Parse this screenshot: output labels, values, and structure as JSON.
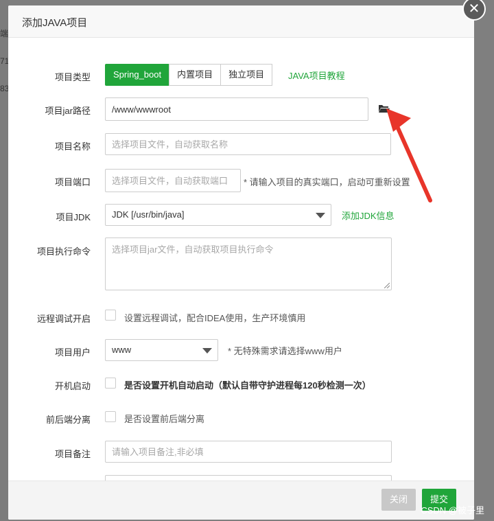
{
  "background": {
    "edge_texts": [
      "端",
      "71",
      "83"
    ]
  },
  "dialog": {
    "title": "添加JAVA项目",
    "close_icon": "close-icon",
    "project_type": {
      "label": "项目类型",
      "options": [
        "Spring_boot",
        "内置项目",
        "独立项目"
      ],
      "selected": "Spring_boot",
      "tutorial_link": "JAVA项目教程"
    },
    "jar_path": {
      "label": "项目jar路径",
      "value": "/www/wwwroot",
      "folder_icon": "folder-open-icon"
    },
    "project_name": {
      "label": "项目名称",
      "placeholder": "选择项目文件，自动获取名称"
    },
    "project_port": {
      "label": "项目端口",
      "placeholder": "选择项目文件，自动获取端口",
      "hint": "* 请输入项目的真实端口，启动可重新设置"
    },
    "project_jdk": {
      "label": "项目JDK",
      "selected": "JDK [/usr/bin/java]",
      "add_link": "添加JDK信息"
    },
    "exec_command": {
      "label": "项目执行命令",
      "placeholder": "选择项目jar文件，自动获取项目执行命令"
    },
    "remote_debug": {
      "label": "远程调试开启",
      "text": "设置远程调试，配合IDEA使用，生产环境慎用",
      "checked": false
    },
    "project_user": {
      "label": "项目用户",
      "selected": "www",
      "hint": "* 无特殊需求请选择www用户"
    },
    "auto_start": {
      "label": "开机启动",
      "text": "是否设置开机自动启动（默认自带守护进程每120秒检测一次）",
      "checked": false
    },
    "separation": {
      "label": "前后端分离",
      "text": "是否设置前后端分离",
      "checked": false
    },
    "remark": {
      "label": "项目备注",
      "placeholder": "请输入项目备注,非必填"
    },
    "buttons": {
      "close": "关闭",
      "submit": "提交"
    }
  },
  "colors": {
    "accent": "#20a53a",
    "arrow": "#e8352a",
    "close_btn_disabled": "#c8c8c8"
  },
  "watermark": "CSDN @被子里"
}
